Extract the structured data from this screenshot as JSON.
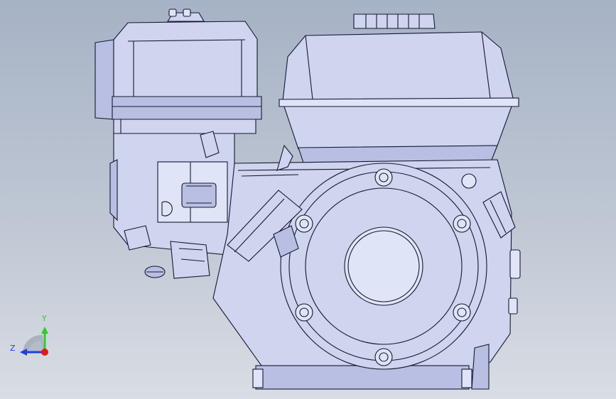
{
  "viewport": {
    "title": "",
    "model": "engine-front-view",
    "background_top": "#a6b2c5",
    "background_bottom": "#d9dde4",
    "part_color": "#cfd4ef",
    "edge_color": "#141832"
  },
  "triad": {
    "y_label": "Y",
    "z_label": "Z",
    "y_color": "#2ecc2e",
    "z_color": "#1f3fe0",
    "x_color": "#e01818"
  }
}
